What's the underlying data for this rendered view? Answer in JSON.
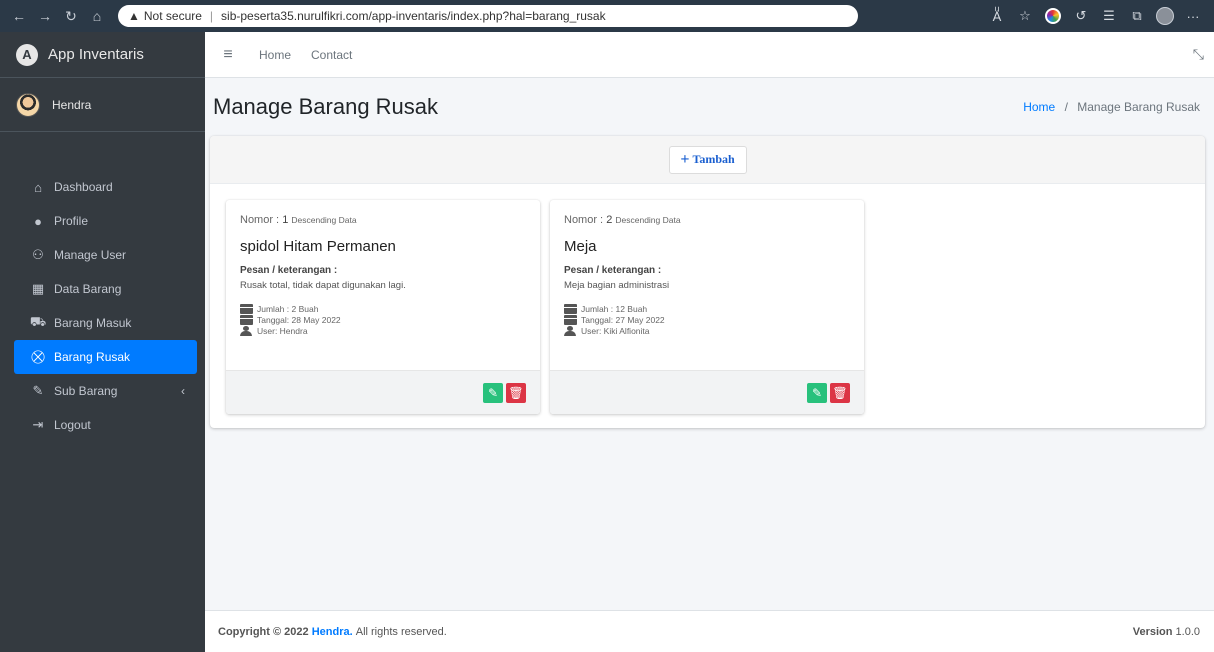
{
  "browser": {
    "security_warning": "Not secure",
    "url": "sib-peserta35.nurulfikri.com/app-inventaris/index.php?hal=barang_rusak",
    "extension_colorful": "#e53935"
  },
  "sidebar": {
    "brand": "App Inventaris",
    "brand_logo": "A",
    "user_name": "Hendra",
    "items": [
      {
        "label": "Dashboard",
        "icon": "home-icon",
        "glyph": "⌂"
      },
      {
        "label": "Profile",
        "icon": "user-icon",
        "glyph": "●"
      },
      {
        "label": "Manage User",
        "icon": "users-icon",
        "glyph": "⚇"
      },
      {
        "label": "Data Barang",
        "icon": "boxes-icon",
        "glyph": "▦"
      },
      {
        "label": "Barang Masuk",
        "icon": "dolly-icon",
        "glyph": "⛟"
      },
      {
        "label": "Barang Rusak",
        "icon": "broken-box-icon",
        "glyph": "⛒"
      },
      {
        "label": "Sub Barang",
        "icon": "edit-icon",
        "glyph": "✎"
      },
      {
        "label": "Logout",
        "icon": "sign-out-icon",
        "glyph": "⇥"
      }
    ],
    "active_color": "#007bff"
  },
  "navbar": {
    "home": "Home",
    "contact": "Contact"
  },
  "header": {
    "title": "Manage Barang Rusak",
    "breadcrumb_home": "Home",
    "breadcrumb_sep": "/",
    "breadcrumb_current": "Manage Barang Rusak"
  },
  "main": {
    "add_button_label": "Tambah",
    "add_button_plus": "+",
    "cards": [
      {
        "nomor_label": "Nomor :",
        "nomor": "1",
        "descending": "Descending Data",
        "title": "spidol Hitam Permanen",
        "pesan_label": "Pesan / keterangan :",
        "pesan": "Rusak total, tidak dapat digunakan lagi.",
        "jumlah": "Jumlah : 2 Buah",
        "tanggal": "Tanggal: 28 May 2022",
        "user": "User: Hendra"
      },
      {
        "nomor_label": "Nomor :",
        "nomor": "2",
        "descending": "Descending Data",
        "title": "Meja",
        "pesan_label": "Pesan / keterangan :",
        "pesan": "Meja bagian administrasi",
        "jumlah": "Jumlah : 12 Buah",
        "tanggal": "Tanggal: 27 May 2022",
        "user": "User: Kiki Alfionita"
      }
    ],
    "edit_color": "#28c17c",
    "delete_color": "#dc3545"
  },
  "footer": {
    "copyright": "Copyright © 2022",
    "author": "Hendra.",
    "rights": "All rights reserved.",
    "version_label": "Version",
    "version": "1.0.0"
  }
}
